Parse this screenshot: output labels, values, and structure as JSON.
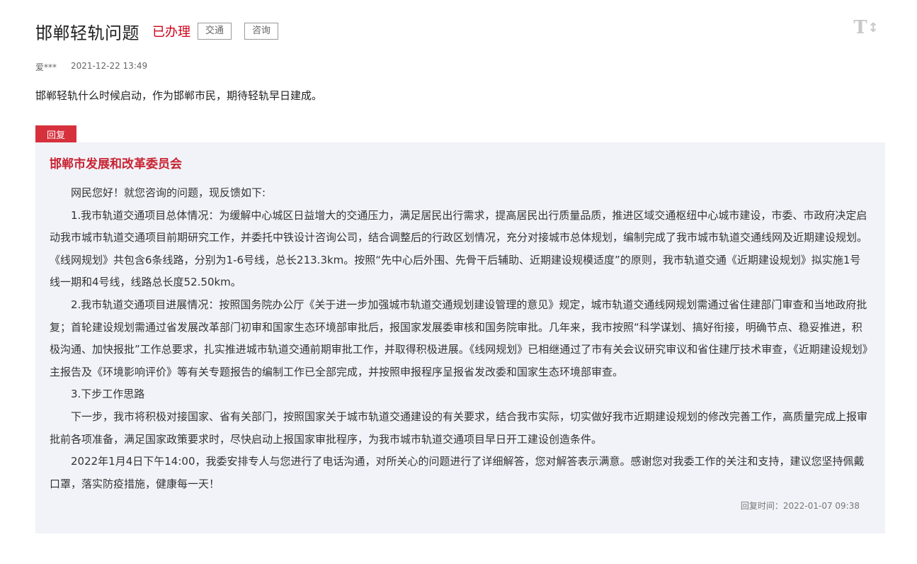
{
  "header": {
    "title": "邯郸轻轨问题",
    "status": "已办理",
    "tags": [
      "交通",
      "咨询"
    ],
    "font_size_toggle": "T↕"
  },
  "meta": {
    "author": "爱***",
    "date": "2021-12-22 13:49"
  },
  "question": "邯郸轻轨什么时候启动，作为邯郸市民，期待轻轨早日建成。",
  "reply": {
    "tag": "回复",
    "organization": "邯郸市发展和改革委员会",
    "paragraphs": [
      "网民您好！就您咨询的问题，现反馈如下:",
      "1.我市轨道交通项目总体情况：为缓解中心城区日益增大的交通压力，满足居民出行需求，提高居民出行质量品质，推进区域交通枢纽中心城市建设，市委、市政府决定启动我市城市轨道交通项目前期研究工作，并委托中铁设计咨询公司，结合调整后的行政区划情况，充分对接城市总体规划，编制完成了我市城市轨道交通线网及近期建设规划。《线网规划》共包含6条线路，分别为1-6号线，总长213.3km。按照“先中心后外围、先骨干后辅助、近期建设规模适度”的原则，我市轨道交通《近期建设规划》拟实施1号线一期和4号线，线路总长度52.50km。",
      "2.我市轨道交通项目进展情况：按照国务院办公厅《关于进一步加强城市轨道交通规划建设管理的意见》规定，城市轨道交通线网规划需通过省住建部门审查和当地政府批复；首轮建设规划需通过省发展改革部门初审和国家生态环境部审批后，报国家发展委审核和国务院审批。几年来，我市按照“科学谋划、搞好衔接，明确节点、稳妥推进，积极沟通、加快报批”工作总要求，扎实推进城市轨道交通前期审批工作，并取得积极进展。《线网规划》已相继通过了市有关会议研究审议和省住建厅技术审查，《近期建设规划》主报告及《环境影响评价》等有关专题报告的编制工作已全部完成，并按照申报程序呈报省发改委和国家生态环境部审查。",
      "3.下步工作思路",
      "下一步，我市将积极对接国家、省有关部门，按照国家关于城市轨道交通建设的有关要求，结合我市实际，切实做好我市近期建设规划的修改完善工作，高质量完成上报审批前各项准备，满足国家政策要求时，尽快启动上报国家审批程序，为我市城市轨道交通项目早日开工建设创造条件。",
      "2022年1月4日下午14:00，我委安排专人与您进行了电话沟通，对所关心的问题进行了详细解答，您对解答表示满意。感谢您对我委工作的关注和支持，建议您坚持佩戴口罩，落实防疫措施，健康每一天！"
    ],
    "time_label": "回复时间：",
    "time": "2022-01-07 09:38"
  },
  "colors": {
    "accent_red": "#d7303d",
    "reply_background": "#f1f3f8"
  }
}
